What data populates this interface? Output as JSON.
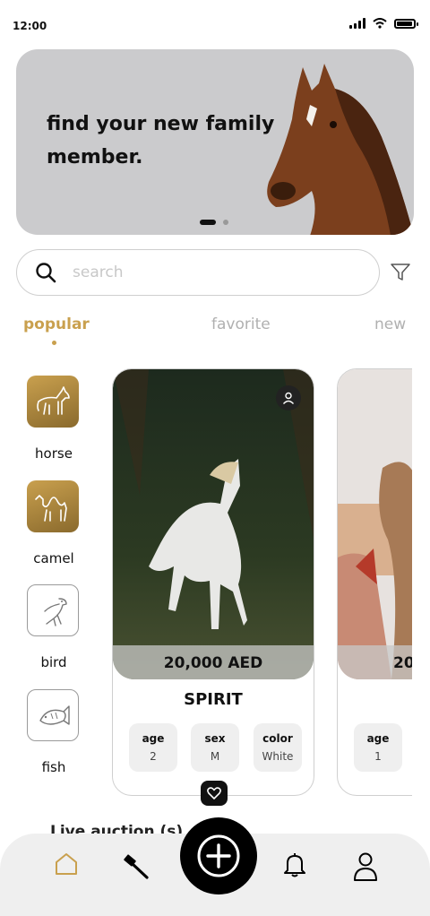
{
  "status": {
    "time": "12:00"
  },
  "banner": {
    "headline": "find your new family member.",
    "slides": 2,
    "active_slide": 1
  },
  "search": {
    "placeholder": "search",
    "value": ""
  },
  "tabs": [
    {
      "label": "popular",
      "active": true
    },
    {
      "label": "favorite",
      "active": false
    },
    {
      "label": "new",
      "active": false
    }
  ],
  "categories": [
    {
      "label": "horse",
      "icon": "horse-icon"
    },
    {
      "label": "camel",
      "icon": "camel-icon"
    },
    {
      "label": "bird",
      "icon": "bird-icon"
    },
    {
      "label": "fish",
      "icon": "fish-icon"
    }
  ],
  "cards": [
    {
      "price": "20,000 AED",
      "name": "SPIRIT",
      "attributes": [
        {
          "label": "age",
          "value": "2"
        },
        {
          "label": "sex",
          "value": "M"
        },
        {
          "label": "color",
          "value": "White"
        }
      ]
    },
    {
      "price": "20",
      "attributes": [
        {
          "label": "age",
          "value": "1"
        }
      ]
    }
  ],
  "live_section": {
    "title": "Live auction (s)"
  },
  "nav": {
    "items": [
      "home-icon",
      "auction-hammer-icon",
      "add-icon",
      "bell-icon",
      "profile-icon"
    ]
  },
  "colors": {
    "accent": "#c9a04e",
    "dark": "#111111",
    "banner_bg": "#cbcbcd"
  }
}
